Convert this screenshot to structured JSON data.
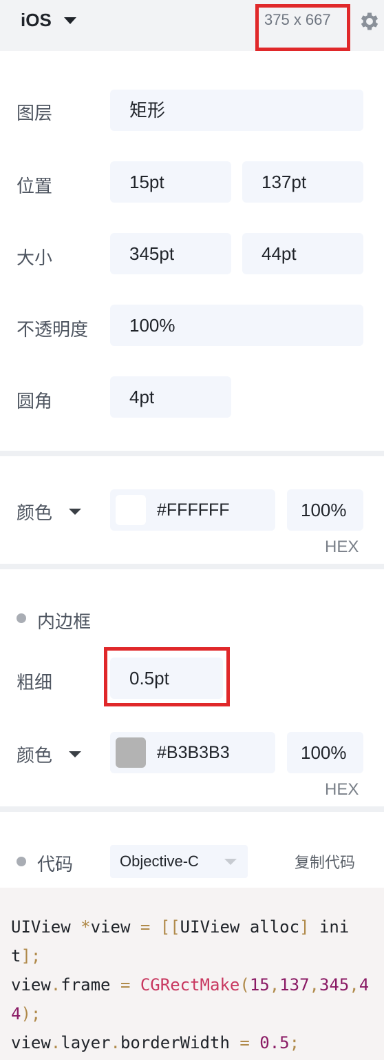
{
  "topbar": {
    "platform": "iOS",
    "screen_size": "375 x 667"
  },
  "icons": {
    "platform_dropdown": "chevron-down-icon",
    "settings": "gear-icon"
  },
  "layer": {
    "label": "图层",
    "value": "矩形"
  },
  "position": {
    "label": "位置",
    "x": "15pt",
    "y": "137pt"
  },
  "size": {
    "label": "大小",
    "width": "345pt",
    "height": "44pt"
  },
  "opacity": {
    "label": "不透明度",
    "value": "100%"
  },
  "radius": {
    "label": "圆角",
    "value": "4pt"
  },
  "fill": {
    "label": "颜色",
    "hex": "#FFFFFF",
    "alpha": "100%",
    "format": "HEX",
    "swatch_color": "#ffffff"
  },
  "border": {
    "section_title": "内边框",
    "thickness_label": "粗细",
    "thickness": "0.5pt",
    "color_label": "颜色",
    "hex": "#B3B3B3",
    "alpha": "100%",
    "format": "HEX",
    "swatch_color": "#b3b3b3"
  },
  "code": {
    "section_title": "代码",
    "language": "Objective-C",
    "copy_label": "复制代码",
    "lines": [
      "UIView *view = [[UIView alloc] init];",
      "view.frame = CGRectMake(15,137,345,44);",
      "view.layer.borderWidth = 0.5;"
    ]
  },
  "colors": {
    "highlight": "#e0282a",
    "field_bg": "#f3f6fc",
    "header_bg": "#f2f3f5"
  }
}
